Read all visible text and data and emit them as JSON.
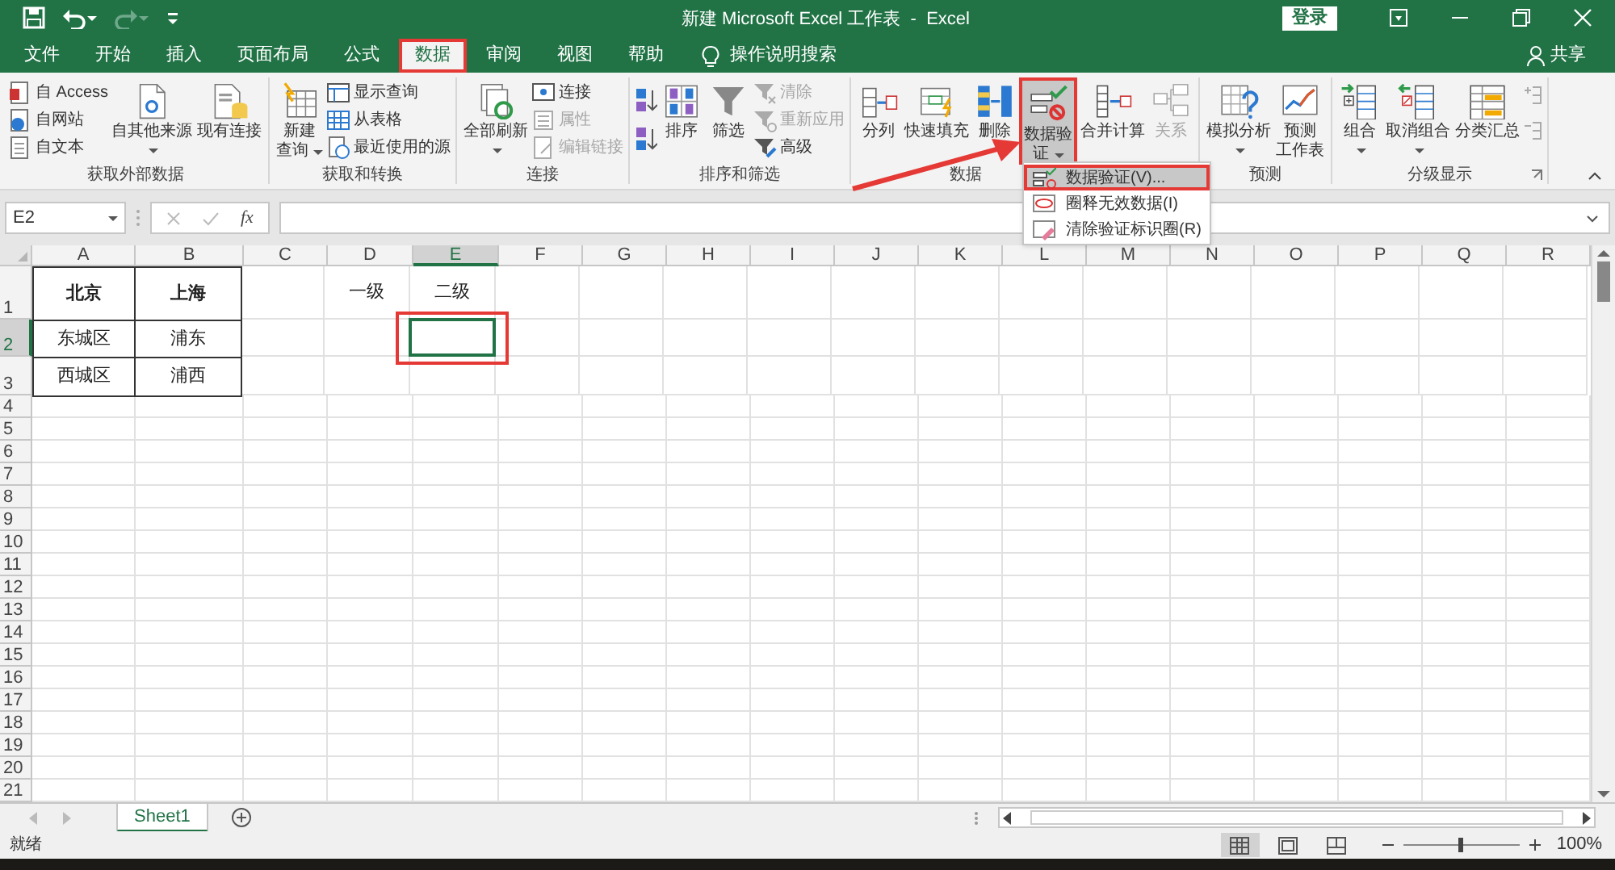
{
  "window": {
    "title": "新建 Microsoft Excel 工作表  -  Excel",
    "sign_in": "登录"
  },
  "tabs": [
    {
      "label": "文件",
      "selected": false,
      "highlighted": false
    },
    {
      "label": "开始",
      "selected": false,
      "highlighted": false
    },
    {
      "label": "插入",
      "selected": false,
      "highlighted": false
    },
    {
      "label": "页面布局",
      "selected": false,
      "highlighted": false
    },
    {
      "label": "公式",
      "selected": false,
      "highlighted": false
    },
    {
      "label": "数据",
      "selected": true,
      "highlighted": true
    },
    {
      "label": "审阅",
      "selected": false,
      "highlighted": false
    },
    {
      "label": "视图",
      "selected": false,
      "highlighted": false
    },
    {
      "label": "帮助",
      "selected": false,
      "highlighted": false
    }
  ],
  "tell_me": "操作说明搜索",
  "share": "共享",
  "ribbon": [
    {
      "label": "获取外部数据",
      "columns": [
        {
          "kind": "stack",
          "items": [
            {
              "label": "自 Access",
              "disabled": false
            },
            {
              "label": "自网站",
              "disabled": false
            },
            {
              "label": "自文本",
              "disabled": false
            }
          ]
        },
        {
          "kind": "large",
          "lines": [
            "自其他来源"
          ],
          "dropdown": true,
          "disabled": false,
          "highlighted": false
        },
        {
          "kind": "large",
          "lines": [
            "现有连接"
          ],
          "dropdown": false,
          "disabled": false,
          "highlighted": false
        }
      ]
    },
    {
      "label": "获取和转换",
      "columns": [
        {
          "kind": "large",
          "lines": [
            "新建",
            "查询"
          ],
          "dropdown": true,
          "disabled": false,
          "highlighted": false
        },
        {
          "kind": "stack",
          "items": [
            {
              "label": "显示查询",
              "disabled": false
            },
            {
              "label": "从表格",
              "disabled": false
            },
            {
              "label": "最近使用的源",
              "disabled": false
            }
          ]
        }
      ]
    },
    {
      "label": "连接",
      "columns": [
        {
          "kind": "large",
          "lines": [
            "全部刷新"
          ],
          "dropdown": true,
          "disabled": false,
          "highlighted": false
        },
        {
          "kind": "stack",
          "items": [
            {
              "label": "连接",
              "disabled": false
            },
            {
              "label": "属性",
              "disabled": true
            },
            {
              "label": "编辑链接",
              "disabled": true
            }
          ]
        }
      ]
    },
    {
      "label": "排序和筛选",
      "columns": [
        {
          "kind": "sort"
        },
        {
          "kind": "large",
          "lines": [
            "排序"
          ],
          "dropdown": false,
          "disabled": false,
          "highlighted": false
        },
        {
          "kind": "large",
          "lines": [
            "筛选"
          ],
          "dropdown": false,
          "disabled": false,
          "highlighted": false
        },
        {
          "kind": "stack",
          "items": [
            {
              "label": "清除",
              "disabled": true
            },
            {
              "label": "重新应用",
              "disabled": true
            },
            {
              "label": "高级",
              "disabled": false
            }
          ]
        }
      ]
    },
    {
      "label": "数据",
      "columns": [
        {
          "kind": "large",
          "lines": [
            "分列"
          ],
          "dropdown": false,
          "disabled": false,
          "highlighted": false
        },
        {
          "kind": "large",
          "lines": [
            "快速填充"
          ],
          "dropdown": false,
          "disabled": false,
          "highlighted": false
        },
        {
          "kind": "large",
          "lines": [
            "删除"
          ],
          "dropdown": false,
          "disabled": false,
          "highlighted": false
        },
        {
          "kind": "large",
          "lines": [
            "数据验",
            "证"
          ],
          "dropdown": true,
          "disabled": false,
          "highlighted": true
        },
        {
          "kind": "large",
          "lines": [
            "合并计算"
          ],
          "dropdown": false,
          "disabled": false,
          "highlighted": false
        },
        {
          "kind": "large",
          "lines": [
            "关系"
          ],
          "dropdown": false,
          "disabled": true,
          "highlighted": false
        }
      ]
    },
    {
      "label": "预测",
      "columns": [
        {
          "kind": "large",
          "lines": [
            "模拟分析"
          ],
          "dropdown": true,
          "disabled": false,
          "highlighted": false
        },
        {
          "kind": "large",
          "lines": [
            "预测",
            "工作表"
          ],
          "dropdown": false,
          "disabled": false,
          "highlighted": false
        }
      ]
    },
    {
      "label": "分级显示",
      "columns": [
        {
          "kind": "large",
          "lines": [
            "组合"
          ],
          "dropdown": true,
          "disabled": false,
          "highlighted": false
        },
        {
          "kind": "large",
          "lines": [
            "取消组合"
          ],
          "dropdown": true,
          "disabled": false,
          "highlighted": false
        },
        {
          "kind": "large",
          "lines": [
            "分类汇总"
          ],
          "dropdown": false,
          "disabled": false,
          "highlighted": false
        },
        {
          "kind": "outline"
        }
      ]
    }
  ],
  "menu": [
    {
      "label": "数据验证(V)...",
      "selected": true,
      "highlighted": true
    },
    {
      "label": "圈释无效数据(I)",
      "selected": false,
      "highlighted": false
    },
    {
      "label": "清除验证标识圈(R)",
      "selected": false,
      "highlighted": false
    }
  ],
  "formula_bar": {
    "name_box": "E2",
    "function_label": "fx"
  },
  "grid": {
    "columns": [
      {
        "label": "A",
        "selected": false
      },
      {
        "label": "B",
        "selected": false
      },
      {
        "label": "C",
        "selected": false
      },
      {
        "label": "D",
        "selected": false
      },
      {
        "label": "E",
        "selected": true
      },
      {
        "label": "F",
        "selected": false
      },
      {
        "label": "G",
        "selected": false
      },
      {
        "label": "H",
        "selected": false
      },
      {
        "label": "I",
        "selected": false
      },
      {
        "label": "J",
        "selected": false
      },
      {
        "label": "K",
        "selected": false
      },
      {
        "label": "L",
        "selected": false
      },
      {
        "label": "M",
        "selected": false
      },
      {
        "label": "N",
        "selected": false
      },
      {
        "label": "O",
        "selected": false
      },
      {
        "label": "P",
        "selected": false
      },
      {
        "label": "Q",
        "selected": false
      },
      {
        "label": "R",
        "selected": false
      }
    ],
    "rows": [
      {
        "label": "1",
        "selected": false,
        "cells": [
          {
            "text": "北京",
            "bold": true,
            "bordered": true
          },
          {
            "text": "上海",
            "bold": true,
            "bordered": true
          },
          {},
          {
            "text": "一级",
            "bold": false,
            "bordered": false
          },
          {
            "text": "二级",
            "bold": false,
            "bordered": false
          }
        ]
      },
      {
        "label": "2",
        "selected": true,
        "cells": [
          {
            "text": "东城区",
            "bold": false,
            "bordered": true
          },
          {
            "text": "浦东",
            "bold": false,
            "bordered": true
          },
          {},
          {},
          {
            "selected": true,
            "highlighted": true
          }
        ]
      },
      {
        "label": "3",
        "selected": false,
        "cells": [
          {
            "text": "西城区",
            "bold": false,
            "bordered": true
          },
          {
            "text": "浦西",
            "bold": false,
            "bordered": true
          }
        ]
      },
      {
        "label": "4",
        "selected": false
      },
      {
        "label": "5",
        "selected": false
      },
      {
        "label": "6",
        "selected": false
      },
      {
        "label": "7",
        "selected": false
      },
      {
        "label": "8",
        "selected": false
      },
      {
        "label": "9",
        "selected": false
      },
      {
        "label": "10",
        "selected": false
      },
      {
        "label": "11",
        "selected": false
      },
      {
        "label": "12",
        "selected": false
      },
      {
        "label": "13",
        "selected": false
      },
      {
        "label": "14",
        "selected": false
      },
      {
        "label": "15",
        "selected": false
      },
      {
        "label": "16",
        "selected": false
      },
      {
        "label": "17",
        "selected": false
      },
      {
        "label": "18",
        "selected": false
      },
      {
        "label": "19",
        "selected": false
      },
      {
        "label": "20",
        "selected": false
      },
      {
        "label": "21",
        "selected": false
      }
    ]
  },
  "sheets": [
    {
      "label": "Sheet1",
      "selected": true
    }
  ],
  "status_bar": {
    "status": "就绪",
    "view": [
      {
        "selected": true
      },
      {
        "selected": false
      },
      {
        "selected": false
      }
    ],
    "zoom": {
      "level": 0.5,
      "reading": "100%"
    }
  }
}
